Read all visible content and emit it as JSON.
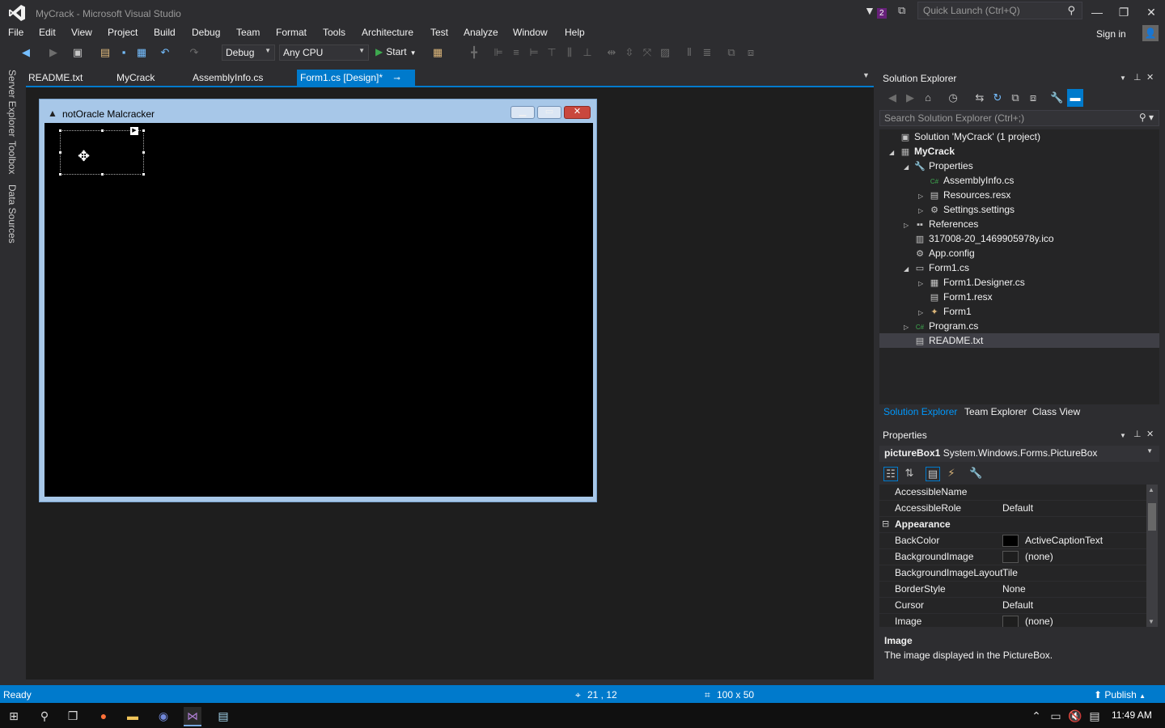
{
  "window": {
    "title": "MyCrack - Microsoft Visual Studio",
    "notification_count": "2",
    "quick_launch_placeholder": "Quick Launch (Ctrl+Q)",
    "sign_in": "Sign in"
  },
  "menu": [
    "File",
    "Edit",
    "View",
    "Project",
    "Build",
    "Debug",
    "Team",
    "Format",
    "Tools",
    "Architecture",
    "Test",
    "Analyze",
    "Window",
    "Help"
  ],
  "toolbar": {
    "config": "Debug",
    "platform": "Any CPU",
    "start": "Start"
  },
  "left_side_tabs": [
    "Server Explorer",
    "Toolbox",
    "Data Sources"
  ],
  "doc_tabs": [
    {
      "label": "README.txt",
      "active": false
    },
    {
      "label": "MyCrack",
      "active": false
    },
    {
      "label": "AssemblyInfo.cs",
      "active": false
    },
    {
      "label": "Form1.cs [Design]*",
      "active": true
    }
  ],
  "designer": {
    "form_title": "notOracle Malcracker"
  },
  "solution_explorer": {
    "title": "Solution Explorer",
    "search_placeholder": "Search Solution Explorer (Ctrl+;)",
    "tree": [
      {
        "label": "Solution 'MyCrack' (1 project)",
        "indent": 0,
        "expander": "",
        "icon": "solution-icon",
        "bold": false
      },
      {
        "label": "MyCrack",
        "indent": 0,
        "expander": "◢",
        "icon": "csharp-project-icon",
        "bold": true
      },
      {
        "label": "Properties",
        "indent": 1,
        "expander": "◢",
        "icon": "wrench-icon",
        "bold": false
      },
      {
        "label": "AssemblyInfo.cs",
        "indent": 2,
        "expander": "",
        "icon": "csharp-file-icon",
        "bold": false
      },
      {
        "label": "Resources.resx",
        "indent": 2,
        "expander": "▷",
        "icon": "resx-file-icon",
        "bold": false
      },
      {
        "label": "Settings.settings",
        "indent": 2,
        "expander": "▷",
        "icon": "settings-gear-icon",
        "bold": false
      },
      {
        "label": "References",
        "indent": 1,
        "expander": "▷",
        "icon": "references-icon",
        "bold": false
      },
      {
        "label": "317008-20_1469905978y.ico",
        "indent": 1,
        "expander": "",
        "icon": "ico-file-icon",
        "bold": false
      },
      {
        "label": "App.config",
        "indent": 1,
        "expander": "",
        "icon": "config-file-icon",
        "bold": false
      },
      {
        "label": "Form1.cs",
        "indent": 1,
        "expander": "◢",
        "icon": "form-file-icon",
        "bold": false
      },
      {
        "label": "Form1.Designer.cs",
        "indent": 2,
        "expander": "▷",
        "icon": "designer-file-icon",
        "bold": false
      },
      {
        "label": "Form1.resx",
        "indent": 2,
        "expander": "",
        "icon": "resx-file-icon",
        "bold": false
      },
      {
        "label": "Form1",
        "indent": 2,
        "expander": "▷",
        "icon": "form-class-icon",
        "bold": false
      },
      {
        "label": "Program.cs",
        "indent": 1,
        "expander": "▷",
        "icon": "csharp-file-icon",
        "bold": false
      },
      {
        "label": "README.txt",
        "indent": 1,
        "expander": "",
        "icon": "text-file-icon",
        "bold": false,
        "selected": true
      }
    ],
    "bottom_tabs": [
      {
        "label": "Solution Explorer",
        "active": true
      },
      {
        "label": "Team Explorer",
        "active": false
      },
      {
        "label": "Class View",
        "active": false
      }
    ]
  },
  "properties": {
    "title": "Properties",
    "object_name": "pictureBox1",
    "object_type": "System.Windows.Forms.PictureBox",
    "rows": [
      {
        "name": "AccessibleName",
        "value": "",
        "swatch": null,
        "category": false
      },
      {
        "name": "AccessibleRole",
        "value": "Default",
        "swatch": null,
        "category": false
      },
      {
        "name": "Appearance",
        "value": "",
        "swatch": null,
        "category": true
      },
      {
        "name": "BackColor",
        "value": "ActiveCaptionText",
        "swatch": "#000000",
        "category": false
      },
      {
        "name": "BackgroundImage",
        "value": "(none)",
        "swatch": "#1e1e1e",
        "category": false
      },
      {
        "name": "BackgroundImageLayout",
        "value": "Tile",
        "swatch": null,
        "category": false
      },
      {
        "name": "BorderStyle",
        "value": "None",
        "swatch": null,
        "category": false
      },
      {
        "name": "Cursor",
        "value": "Default",
        "swatch": null,
        "category": false
      },
      {
        "name": "Image",
        "value": "(none)",
        "swatch": "#1e1e1e",
        "category": false
      }
    ],
    "desc_title": "Image",
    "desc_text": "The image displayed in the PictureBox."
  },
  "status": {
    "text": "Ready",
    "position": "21 , 12",
    "size": "100 x 50",
    "publish": "Publish"
  },
  "taskbar": {
    "time": "11:49 AM"
  },
  "colors": {
    "accent": "#007acc",
    "vs_purple": "#68217a"
  }
}
